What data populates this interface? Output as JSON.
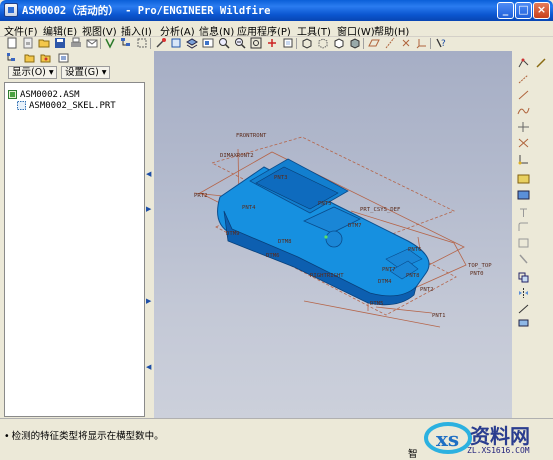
{
  "window": {
    "title": "ASM0002（活动的） - Pro/ENGINEER Wildfire",
    "minimize": "_",
    "maximize": "□",
    "close": "×"
  },
  "menu": [
    "文件(F)",
    "编辑(E)",
    "视图(V)",
    "插入(I)",
    "分析(A)",
    "信息(N)",
    "应用程序(P)",
    "工具(T)",
    "窗口(W)",
    "帮助(H)"
  ],
  "left_panel": {
    "show_button": "显示(O) ▾",
    "settings_button": "设置(G) ▾",
    "tree": [
      {
        "label": "ASM0002.ASM",
        "icon": "assembly-icon"
      },
      {
        "label": "ASM0002_SKEL.PRT",
        "icon": "skeleton-part-icon"
      }
    ]
  },
  "graphics": {
    "labels": [
      "FRONTRONT",
      "DIMAXRONT2",
      "PNT3",
      "PNT4",
      "PNT5",
      "PRT2",
      "PRT_CSYS_DEF",
      "PNT6",
      "DTM8",
      "DTM9",
      "DTM5",
      "RIGHTRIGHT",
      "TOP_TOP",
      "PNT7",
      "PNT0",
      "PNT1",
      "PNT2",
      "DTM6",
      "DTM7",
      "DTM4",
      "PNT8"
    ],
    "colors": {
      "model": "#1690e0",
      "model_dark": "#0d5fb0",
      "datum": "#b5654a",
      "background": "#b8bfd2"
    }
  },
  "status": {
    "message": "检测的特征类型将显示在横型数中。",
    "filter": "智"
  },
  "watermark": {
    "text": "资料网",
    "url": "ZL.XS1616.COM"
  }
}
